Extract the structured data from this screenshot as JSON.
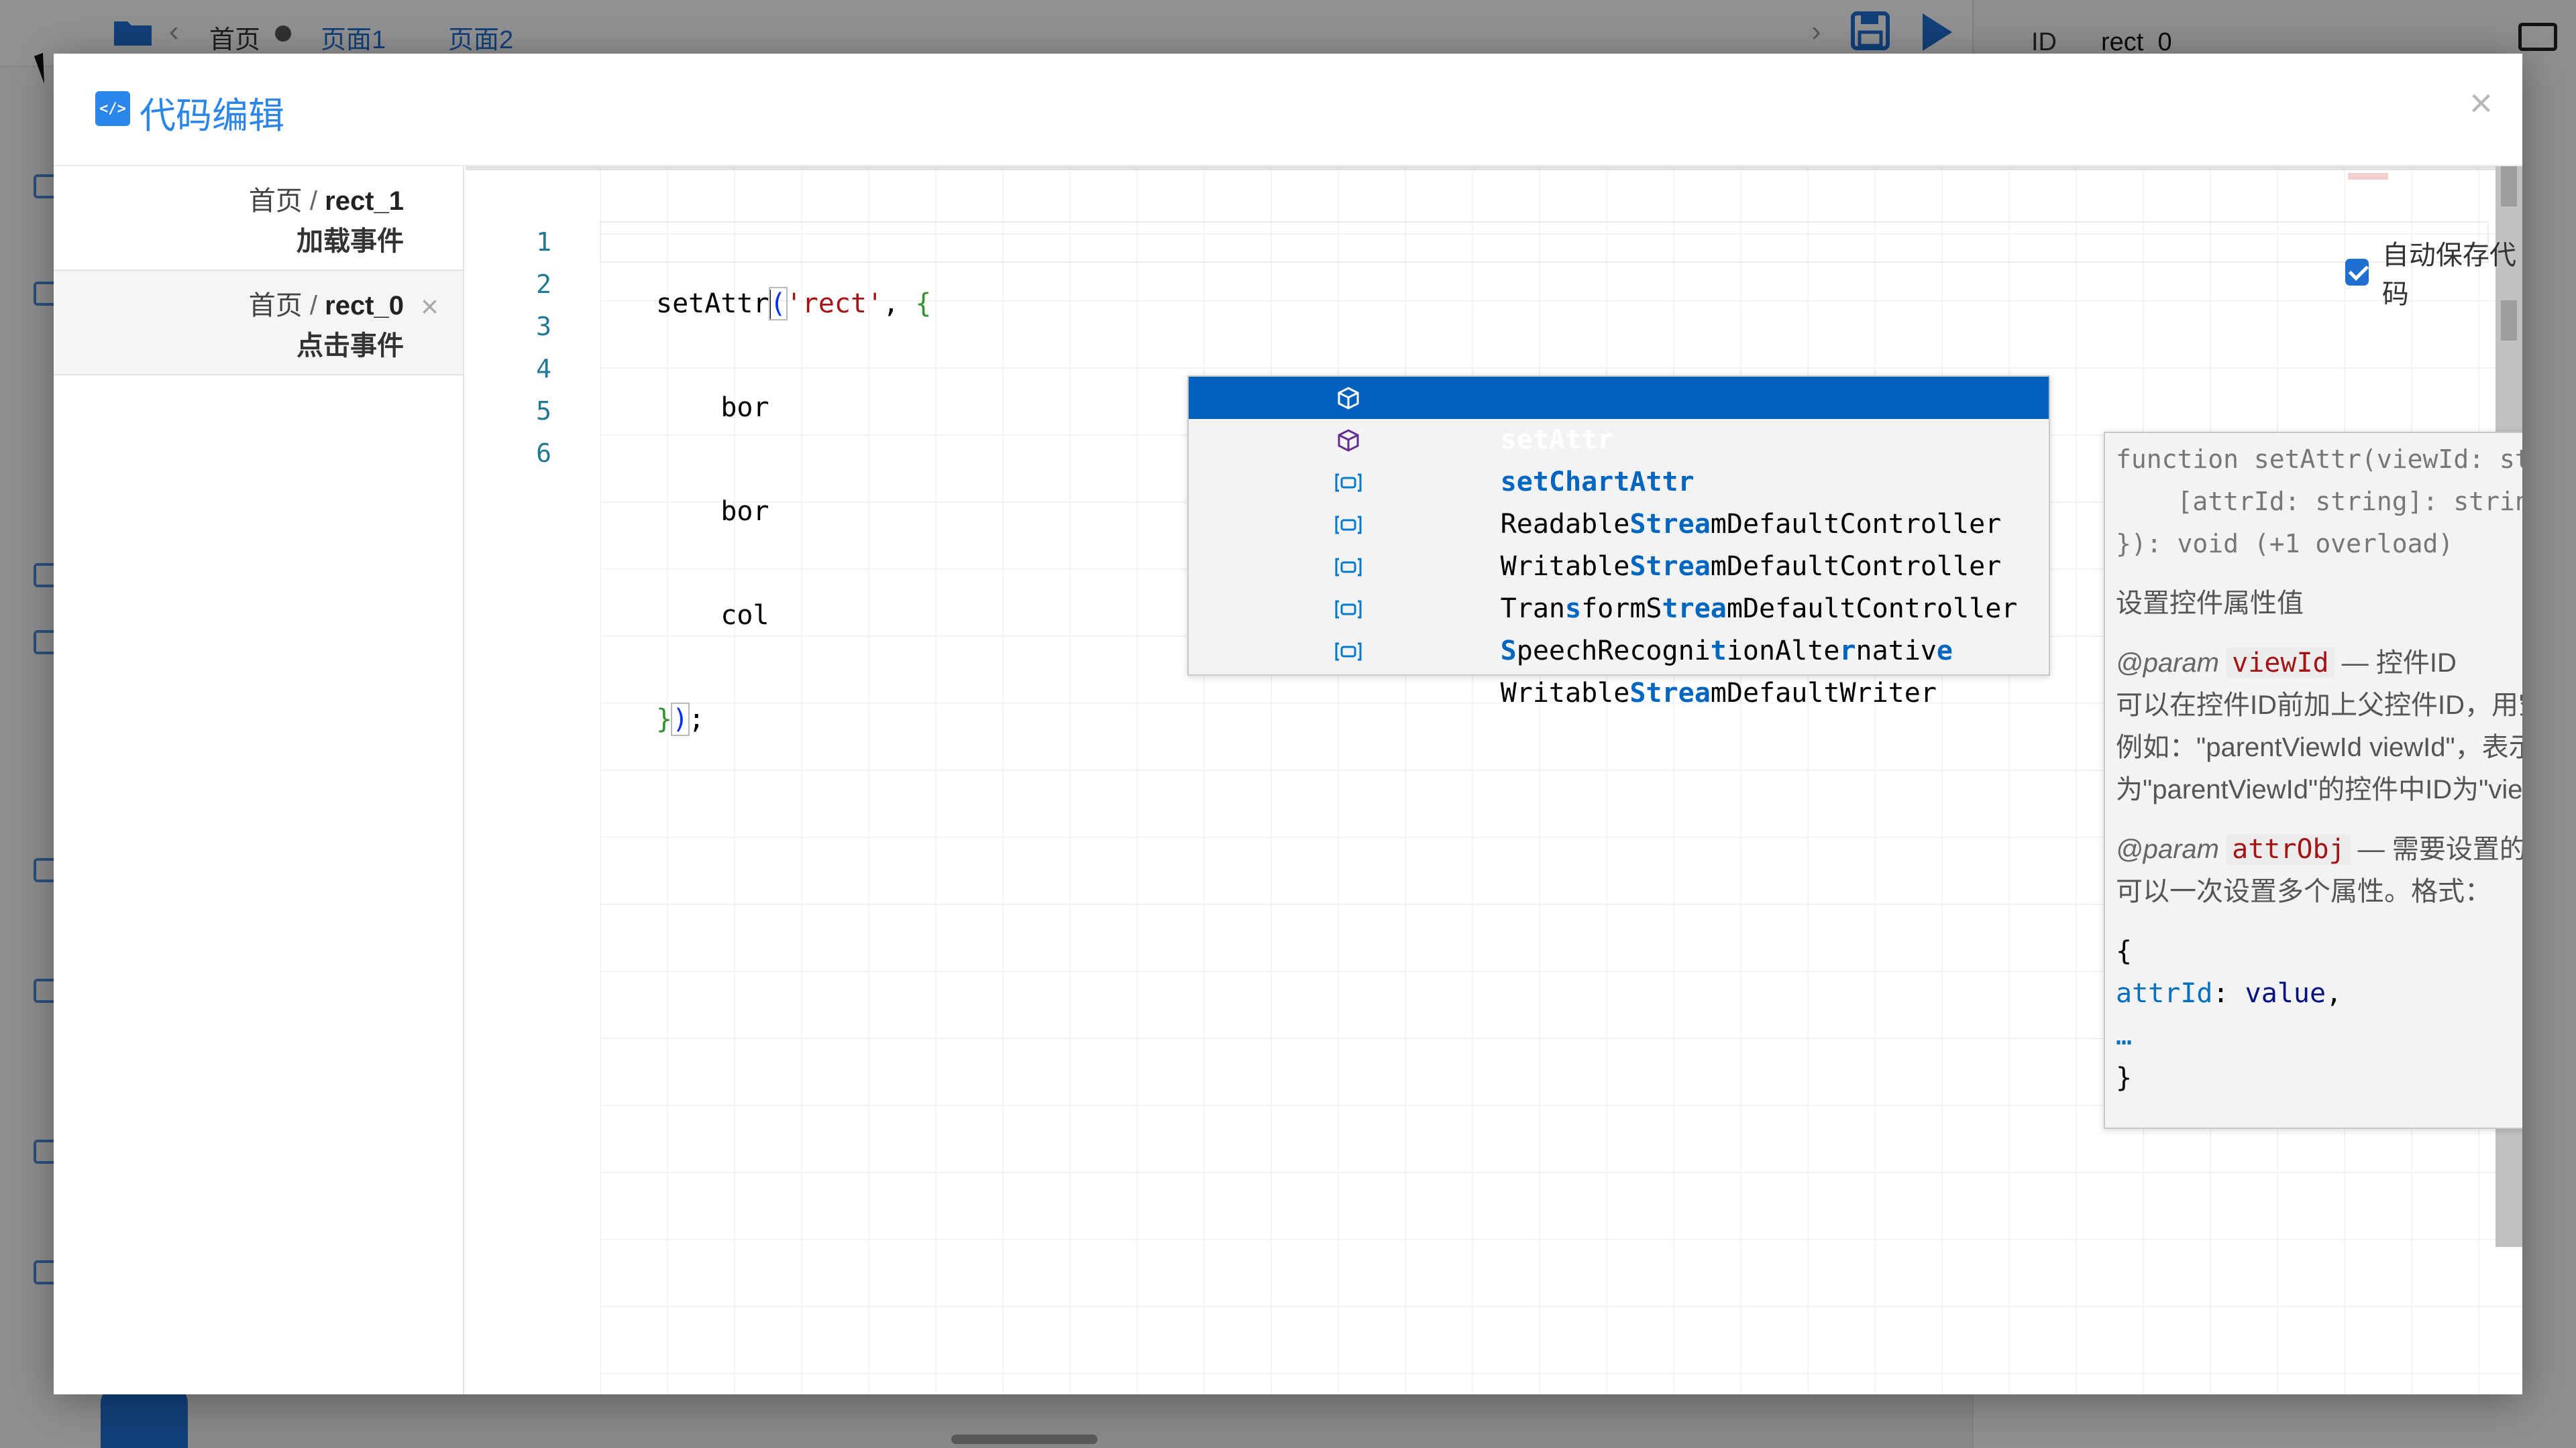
{
  "background": {
    "tabs": [
      "首页",
      "页面1",
      "页面2"
    ],
    "id_label": "ID",
    "id_value": "rect_0"
  },
  "modal": {
    "title": "代码编辑",
    "close": "×"
  },
  "sidebar": {
    "items": [
      {
        "page": "首页",
        "sep": " / ",
        "rect": "rect_1",
        "event": "加载事件",
        "active": false
      },
      {
        "page": "首页",
        "sep": " / ",
        "rect": "rect_0",
        "event": "点击事件",
        "active": true,
        "close": "×"
      }
    ]
  },
  "editor": {
    "line_numbers": [
      "1",
      "2",
      "3",
      "4",
      "5",
      "6"
    ],
    "lines": [
      {
        "pre": "setAttr",
        "post_paren": "(",
        "str": "'rect'",
        "rest": ", ",
        "brace": "{"
      },
      {
        "text": "    bor"
      },
      {
        "text": "    bor"
      },
      {
        "text": "    col"
      },
      {
        "brace": "}",
        "paren": ")",
        "rest": ";"
      },
      {
        "text": ""
      }
    ],
    "autosave_label": "自动保存代码",
    "autosave_checked": true
  },
  "suggest": {
    "items": [
      {
        "label": "setAttr",
        "kind": "method-icon",
        "selected": true
      },
      {
        "label": "setChartAttr",
        "kind": "method-icon",
        "selected": false
      },
      {
        "label": "ReadableStreamDefaultController",
        "kind": "variable-icon",
        "selected": false
      },
      {
        "label": "WritableStreamDefaultController",
        "kind": "variable-icon",
        "selected": false
      },
      {
        "label": "TransformStreamDefaultController",
        "kind": "variable-icon",
        "selected": false
      },
      {
        "label": "SpeechRecognitionAlternative",
        "kind": "variable-icon",
        "selected": false
      },
      {
        "label": "WritableStreamDefaultWriter",
        "kind": "variable-icon",
        "selected": false
      }
    ]
  },
  "doc": {
    "signature": [
      "function setAttr(viewId: string, a…",
      "    [attrId: string]: string | num…",
      "}): void (+1 overload)"
    ],
    "summary": "设置控件属性值",
    "param1_tag": "@param",
    "param1_name": "viewId",
    "param1_desc": " — 控件ID",
    "param1_more1": "可以在控件ID前加上父控件ID，用空格分隔",
    "param1_more2": "例如：\"parentViewId viewId\"，表示获取父控件ID",
    "param1_more3": "为\"parentViewId\"的控件中ID为\"viewId\"的控件",
    "param2_tag": "@param",
    "param2_name": "attrObj",
    "param2_desc": " — 需要设置的属性列表，这样",
    "param2_more": "可以一次设置多个属性。格式：",
    "code_open": "{",
    "code_key": "attrId",
    "code_colon": ": ",
    "code_val": "value",
    "code_comma": ",",
    "code_ellipsis": "…",
    "code_close": "}",
    "close": "×"
  }
}
